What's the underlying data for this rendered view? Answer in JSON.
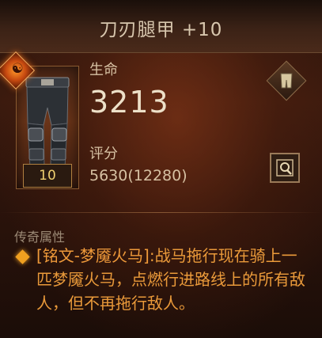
{
  "item": {
    "title": "刀刃腿甲 +10",
    "level": "10",
    "rarity_symbol": "☯"
  },
  "stats": {
    "primary_label": "生命",
    "primary_value": "3213",
    "score_label": "评分",
    "score_value": "5630(12280)"
  },
  "legendary": {
    "section_title": "传奇属性",
    "affix_name": "[铭文-梦魇火马]",
    "affix_text": ":战马拖行现在骑上一匹梦魇火马，点燃行进路线上的所有敌人，但不再拖行敌人。"
  },
  "icons": {
    "rarity": "rarity-flame-icon",
    "compare": "equipped-pants-icon",
    "inspect": "magnify-icon",
    "bullet": "legendary-diamond-icon"
  },
  "colors": {
    "legendary": "#ea9a3a",
    "title": "#d8c7ae",
    "level": "#f0d070"
  }
}
